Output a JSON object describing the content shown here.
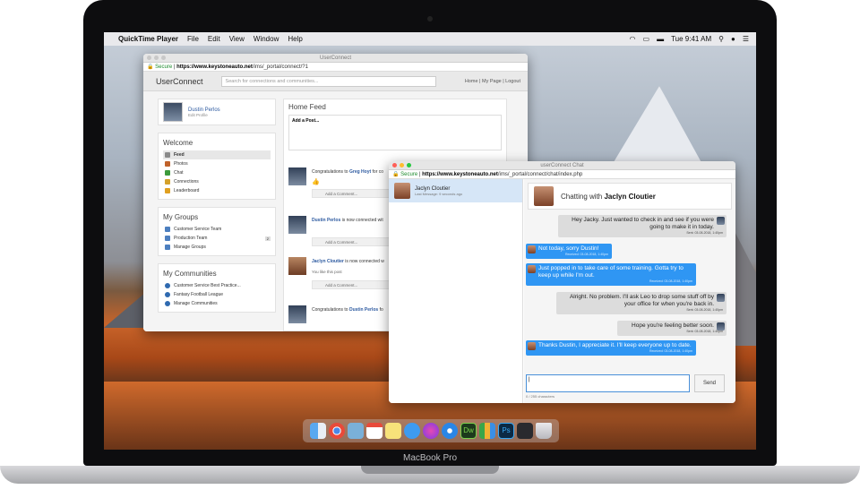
{
  "device": {
    "brand_label": "MacBook Pro"
  },
  "menubar": {
    "apple_icon": "apple-icon",
    "app_name": "QuickTime Player",
    "items": [
      "File",
      "Edit",
      "View",
      "Window",
      "Help"
    ],
    "clock": "Tue 9:41 AM"
  },
  "userconnect_window": {
    "title": "UserConnect",
    "url_secure": "Secure",
    "url_host": "https://www.keystoneauto.net",
    "url_path": "/ims/_portal/connect/?1",
    "brand": "UserConnect",
    "search_placeholder": "Search for connections and communities...",
    "header_links": "Home | My Page | Logout",
    "profile": {
      "name": "Dustin Perlos",
      "edit": "Edit Profile"
    },
    "welcome": {
      "title": "Welcome",
      "items": [
        "Feed",
        "Photos",
        "Chat",
        "Connections",
        "Leaderboard"
      ]
    },
    "groups": {
      "title": "My Groups",
      "items": [
        "Customer Service Team",
        "Production Team",
        "Manage Groups"
      ],
      "badge": "2"
    },
    "communities": {
      "title": "My Communities",
      "items": [
        "Customer Service Best Practice...",
        "Fantasy Football League",
        "Manage Communities"
      ]
    },
    "home_feed": {
      "title": "Home Feed",
      "add_post": "Add a Post...",
      "items": [
        {
          "prefix": "Congratulations to ",
          "name": "Greg Hoyt",
          "suffix": " for co"
        },
        {
          "prefix": "",
          "name": "Dustin Perlos",
          "suffix": " is now connected wit"
        },
        {
          "prefix": "",
          "name": "Jaclyn Cloutier",
          "suffix": " is now connected w"
        },
        {
          "prefix": "Congratulations to ",
          "name": "Dustin Perlos",
          "suffix": " fo"
        }
      ],
      "add_comment": "Add a Comment...",
      "like_text": "You like this post"
    }
  },
  "chat_window": {
    "title": "userConnect Chat",
    "url_secure": "Secure",
    "url_host": "https://www.keystoneauto.net",
    "url_path": "/ims/_portal/connect/chat/index.php",
    "contact": {
      "name": "Jaclyn Cloutier",
      "last_message": "Last Message: 9 seconds ago"
    },
    "header_prefix": "Chatting with ",
    "header_name": "Jaclyn Cloutier",
    "messages": [
      {
        "from": "me",
        "text": "Hey Jacky. Just wanted to check in and see if you were going to make it in today.",
        "time": "Sent: 03-08-2018, 1:40pm"
      },
      {
        "from": "them",
        "text": "Not today, sorry Dustin!",
        "time": "Received: 03-08-2018, 1:40pm"
      },
      {
        "from": "them",
        "text": "Just popped in to take care of some training. Gotta try to keep up while I'm out.",
        "time": "Received: 03-08-2018, 1:40pm"
      },
      {
        "from": "me",
        "text": "Alright. No problem. I'll ask Leo to drop some stuff off by your office for when you're back in.",
        "time": "Sent: 03-08-2018, 1:40pm"
      },
      {
        "from": "me",
        "text": "Hope you're feeling better soon.",
        "time": "Sent: 03-08-2018, 1:40pm"
      },
      {
        "from": "them",
        "text": "Thanks Dustin, I appreciate it. I'll keep everyone up to date.",
        "time": "Received: 03-08-2018, 1:40pm"
      }
    ],
    "send_label": "Send",
    "counter": "0 / 255 characters"
  },
  "dock": {
    "icons": [
      "finder-icon",
      "chrome-icon",
      "preview-icon",
      "calendar-icon",
      "notes-icon",
      "messages-icon",
      "itunes-icon",
      "safari-icon",
      "dreamweaver-icon",
      "numbers-icon",
      "photoshop-icon",
      "quicktime-icon",
      "trash-icon"
    ]
  },
  "colors": {
    "accent": "#2f96f3",
    "link": "#2d5aa0",
    "secure": "#1a8a2a"
  }
}
